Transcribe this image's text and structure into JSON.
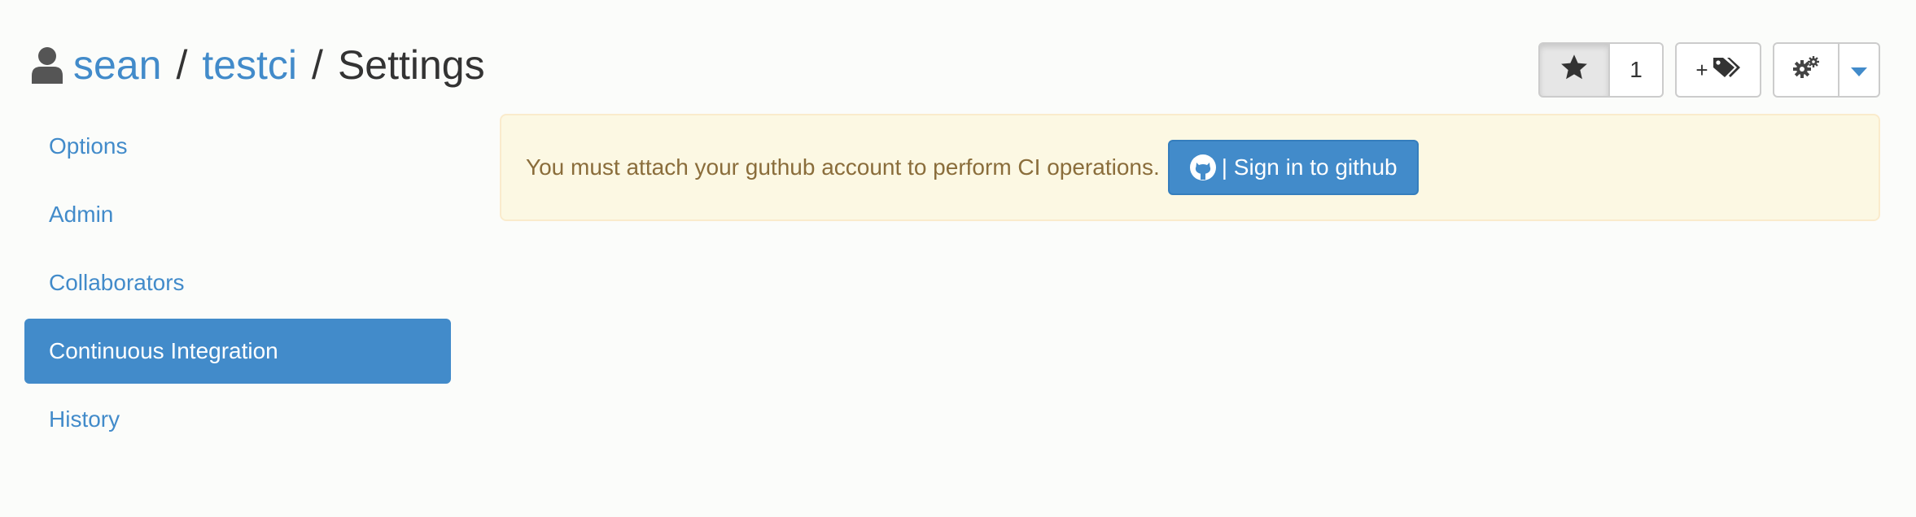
{
  "breadcrumb": {
    "user": "sean",
    "separator": "/",
    "repo": "testci",
    "current": "Settings"
  },
  "toolbar": {
    "star_count": "1",
    "tag_add_symbol": "+"
  },
  "sidebar": {
    "items": [
      {
        "label": "Options",
        "active": false
      },
      {
        "label": "Admin",
        "active": false
      },
      {
        "label": "Collaborators",
        "active": false
      },
      {
        "label": "Continuous Integration",
        "active": true
      },
      {
        "label": "History",
        "active": false
      }
    ]
  },
  "alert": {
    "message": "You must attach your guthub account to perform CI operations.",
    "button_label": "| Sign in to github"
  },
  "icons": {
    "user": "user-icon",
    "star": "star-icon",
    "tags": "tags-icon",
    "gears": "gears-icon",
    "caret": "caret-down-icon",
    "github": "github-icon"
  },
  "colors": {
    "link": "#428bca",
    "active_bg": "#428bca",
    "alert_bg": "#fcf8e3",
    "alert_border": "#faebcc",
    "alert_text": "#8a6d3b"
  }
}
